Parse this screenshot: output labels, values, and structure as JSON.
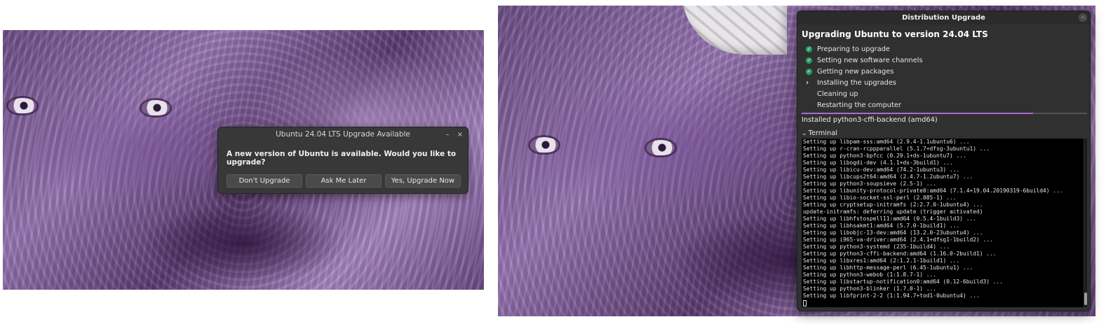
{
  "upgrade_prompt": {
    "title": "Ubuntu 24.04 LTS Upgrade Available",
    "minimize_glyph": "–",
    "close_glyph": "×",
    "message": "A new version of Ubuntu is available. Would you like to upgrade?",
    "buttons": {
      "dont_upgrade": "Don't Upgrade",
      "ask_later": "Ask Me Later",
      "upgrade_now": "Yes, Upgrade Now"
    }
  },
  "distribution_upgrade": {
    "window_title": "Distribution Upgrade",
    "minimize_glyph": "–",
    "heading": "Upgrading Ubuntu to version 24.04 LTS",
    "steps": [
      {
        "label": "Preparing to upgrade",
        "state": "done"
      },
      {
        "label": "Setting new software channels",
        "state": "done"
      },
      {
        "label": "Getting new packages",
        "state": "done"
      },
      {
        "label": "Installing the upgrades",
        "state": "current"
      },
      {
        "label": "Cleaning up",
        "state": "pending"
      },
      {
        "label": "Restarting the computer",
        "state": "pending"
      }
    ],
    "progress_fraction": 0.81,
    "status": "Installed python3-cffi-backend (amd64)",
    "terminal_label": "Terminal",
    "terminal_expanded": true,
    "terminal_lines": [
      "Setting up libpam-sss:amd64 (2.9.4-1.1ubuntu6) ...",
      "Setting up r-cran-rcppparallel (5.1.7+dfsg-3ubuntu1) ...",
      "Setting up python3-bpfcc (0.29.1+ds-1ubuntu7) ...",
      "Setting up libogdi-dev (4.1.1+ds-3build1) ...",
      "Setting up libicu-dev:amd64 (74.2-1ubuntu3) ...",
      "Setting up libcups2t64:amd64 (2.4.7-1.2ubuntu7) ...",
      "Setting up python3-soupsieve (2.5-1) ...",
      "Setting up libunity-protocol-private0:amd64 (7.1.4+19.04.20190319-6build4) ...",
      "Setting up libio-socket-ssl-perl (2.085-1) ...",
      "Setting up cryptsetup-initramfs (2:2.7.0-1ubuntu4) ...",
      "update-initramfs: deferring update (trigger activated)",
      "Setting up libhfstospell11:amd64 (0.5.4-1build3) ...",
      "Setting up libhsakmt1:amd64 (5.7.0-1build1) ...",
      "Setting up libobjc-13-dev:amd64 (13.2.0-23ubuntu4) ...",
      "Setting up i965-va-driver:amd64 (2.4.1+dfsg1-1build2) ...",
      "Setting up python3-systemd (235-1build4) ...",
      "Setting up python3-cffi-backend:amd64 (1.16.0-2build1) ...",
      "Setting up libxres1:amd64 (2:1.2.1-1build1) ...",
      "Setting up libhttp-message-perl (6.45-1ubuntu1) ...",
      "Setting up python3-webob (1:1.8.7-1) ...",
      "Setting up libstartup-notification0:amd64 (0.12-6build3) ...",
      "Setting up python3-blinker (1.7.0-1) ...",
      "Setting up libfprint-2-2 (1:1.94.7+tod1-0ubuntu4) ..."
    ]
  },
  "colors": {
    "accent_progress": "#a86bd3",
    "check_green": "#26a269",
    "dialog_bg": "#383838",
    "window_bg": "#303030",
    "terminal_bg": "#000000"
  }
}
